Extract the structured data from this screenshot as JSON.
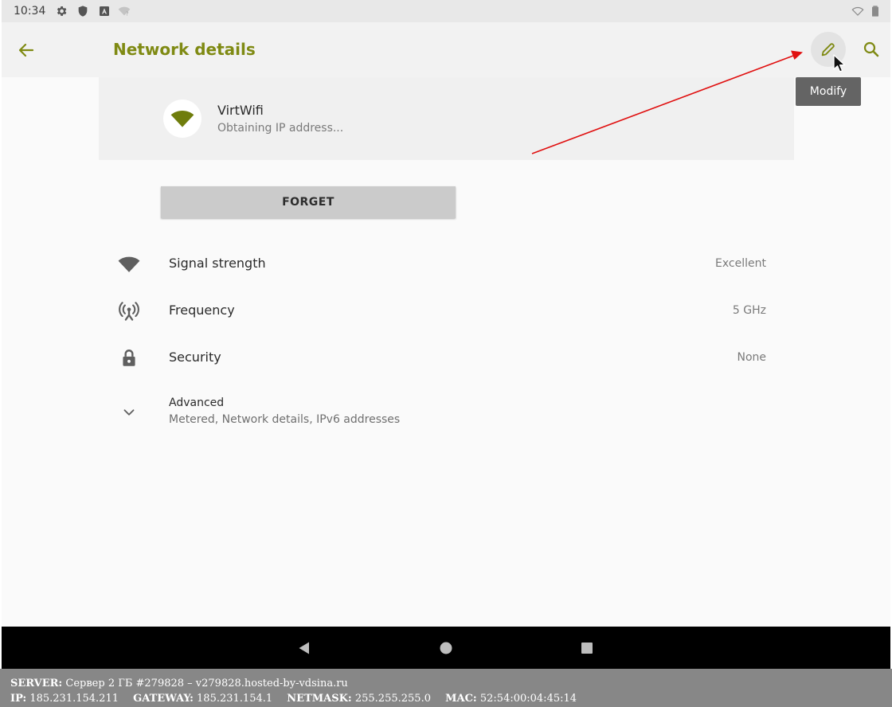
{
  "status_bar": {
    "time": "10:34",
    "icons": [
      "settings-gear-icon",
      "shield-icon",
      "app-a-icon",
      "wifi-question-icon",
      "wifi-outline-icon",
      "battery-icon"
    ]
  },
  "app_bar": {
    "title": "Network details",
    "accent_color": "#7f8a13",
    "actions": [
      "back-arrow-icon",
      "pencil-icon",
      "search-icon"
    ]
  },
  "network": {
    "name": "VirtWifi",
    "status": "Obtaining IP address..."
  },
  "buttons": {
    "forget": "FORGET"
  },
  "details": [
    {
      "icon": "wifi-signal-icon",
      "label": "Signal strength",
      "value": "Excellent"
    },
    {
      "icon": "frequency-antenna-icon",
      "label": "Frequency",
      "value": "5 GHz"
    },
    {
      "icon": "lock-icon",
      "label": "Security",
      "value": "None"
    }
  ],
  "advanced": {
    "title": "Advanced",
    "summary": "Metered, Network details, IPv6 addresses"
  },
  "tooltip": "Modify",
  "nav_bar": [
    "back-triangle-icon",
    "home-circle-icon",
    "recents-square-icon"
  ],
  "server_info": {
    "server_label": "SERVER:",
    "server_value": "Сервер 2 ГБ #279828 – v279828.hosted-by-vdsina.ru",
    "ip_label": "IP:",
    "ip_value": "185.231.154.211",
    "gateway_label": "GATEWAY:",
    "gateway_value": "185.231.154.1",
    "netmask_label": "NETMASK:",
    "netmask_value": "255.255.255.0",
    "mac_label": "MAC:",
    "mac_value": "52:54:00:04:45:14"
  }
}
